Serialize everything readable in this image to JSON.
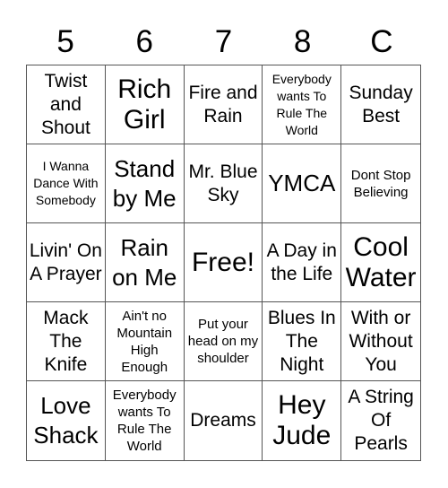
{
  "header": [
    "5",
    "6",
    "7",
    "8",
    "C"
  ],
  "cells": [
    {
      "text": "Twist and Shout",
      "size": "m"
    },
    {
      "text": "Rich Girl",
      "size": "xl"
    },
    {
      "text": "Fire and Rain",
      "size": "m"
    },
    {
      "text": "Everybody wants To Rule The World",
      "size": "xs"
    },
    {
      "text": "Sunday Best",
      "size": "m"
    },
    {
      "text": "I Wanna Dance With Somebody",
      "size": "xs"
    },
    {
      "text": "Stand by Me",
      "size": "l"
    },
    {
      "text": "Mr. Blue Sky",
      "size": "m"
    },
    {
      "text": "YMCA",
      "size": "l"
    },
    {
      "text": "Dont Stop Believing",
      "size": "s"
    },
    {
      "text": "Livin' On A Prayer",
      "size": "m"
    },
    {
      "text": "Rain on Me",
      "size": "l"
    },
    {
      "text": "Free!",
      "size": "xl"
    },
    {
      "text": "A Day in the Life",
      "size": "m"
    },
    {
      "text": "Cool Water",
      "size": "xl"
    },
    {
      "text": "Mack The Knife",
      "size": "m"
    },
    {
      "text": "Ain't no Mountain High Enough",
      "size": "s"
    },
    {
      "text": "Put your head on my shoulder",
      "size": "s"
    },
    {
      "text": "Blues In The Night",
      "size": "m"
    },
    {
      "text": "With or Without You",
      "size": "m"
    },
    {
      "text": "Love Shack",
      "size": "l"
    },
    {
      "text": "Everybody wants To Rule The World",
      "size": "s"
    },
    {
      "text": "Dreams",
      "size": "m"
    },
    {
      "text": "Hey Jude",
      "size": "xl"
    },
    {
      "text": "A String Of Pearls",
      "size": "m"
    }
  ]
}
